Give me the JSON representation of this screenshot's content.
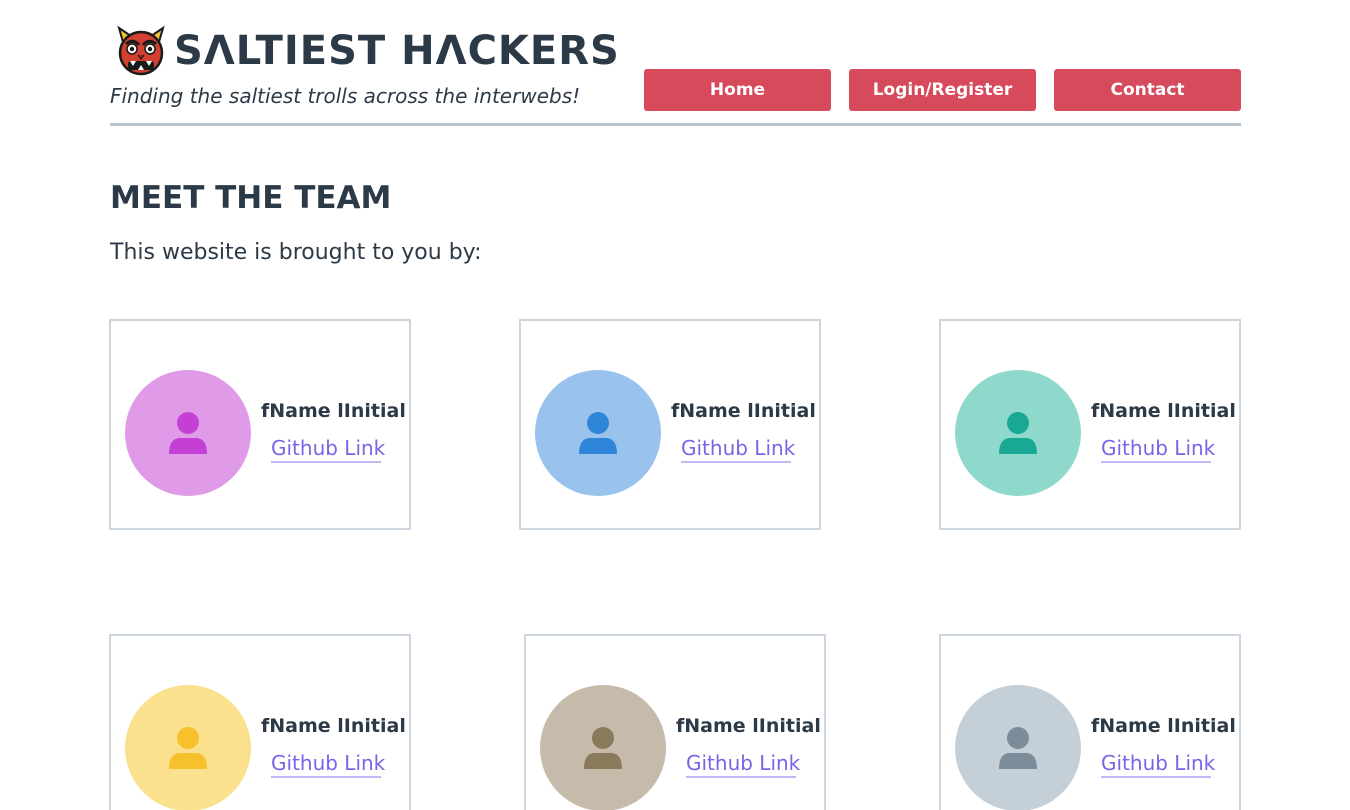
{
  "header": {
    "site_title": "SΛLTIEST HΛCKERS",
    "tagline": "Finding the saltiest trolls across the interwebs!",
    "logo_icon": "oni-mask-icon",
    "nav": [
      {
        "label": "Home"
      },
      {
        "label": "Login/Register"
      },
      {
        "label": "Contact"
      }
    ],
    "nav_color": "#d64a5c"
  },
  "main": {
    "title": "MEET THE TEAM",
    "intro": "This website is brought to you by:"
  },
  "team": [
    {
      "name": "fName lInitial",
      "link": "Github Link",
      "avatar_bg": "#df9be8",
      "avatar_fg": "#c43fd3",
      "icon": "user-icon"
    },
    {
      "name": "fName lInitial",
      "link": "Github Link",
      "avatar_bg": "#99c3ec",
      "avatar_fg": "#2f86d8",
      "icon": "user-icon"
    },
    {
      "name": "fName lInitial",
      "link": "Github Link",
      "avatar_bg": "#8fd8cc",
      "avatar_fg": "#19a893",
      "icon": "user-icon"
    },
    {
      "name": "fName lInitial",
      "link": "Github Link",
      "avatar_bg": "#fbe08e",
      "avatar_fg": "#f6c12c",
      "icon": "user-icon"
    },
    {
      "name": "fName lInitial",
      "link": "Github Link",
      "avatar_bg": "#c6baaa",
      "avatar_fg": "#8a7a5c",
      "icon": "user-icon"
    },
    {
      "name": "fName lInitial",
      "link": "Github Link",
      "avatar_bg": "#c4cfd8",
      "avatar_fg": "#7d8c99",
      "icon": "user-icon"
    }
  ]
}
